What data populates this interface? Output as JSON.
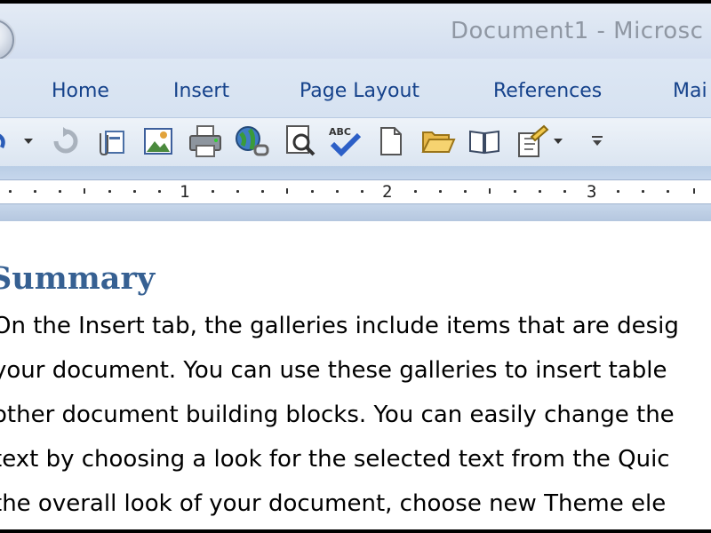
{
  "window": {
    "title": "Document1 - Microsc"
  },
  "ribbon": {
    "tabs": [
      {
        "label": "Home"
      },
      {
        "label": "Insert"
      },
      {
        "label": "Page Layout"
      },
      {
        "label": "References"
      },
      {
        "label": "Mai"
      }
    ]
  },
  "quick_access": {
    "buttons": [
      "undo",
      "undo-dropdown",
      "redo",
      "attach-file",
      "picture",
      "print",
      "web",
      "print-preview",
      "spelling-check",
      "new-document",
      "open-folder",
      "read-mode",
      "format-painter",
      "format-dropdown",
      "customize-toolbar"
    ]
  },
  "ruler": {
    "numbers": [
      "1",
      "2",
      "3"
    ]
  },
  "document": {
    "heading": "Summary",
    "lines": [
      "On the Insert tab, the galleries include items that are desig",
      "your document. You can use these galleries to insert table",
      "other document building blocks. You can easily change the",
      "text by choosing a look for the selected text from the Quic",
      "the overall look of your document, choose new Theme ele"
    ]
  },
  "colors": {
    "heading": "#366092",
    "tab_text": "#15428b",
    "ribbon_bg": "#dbe5f2"
  }
}
